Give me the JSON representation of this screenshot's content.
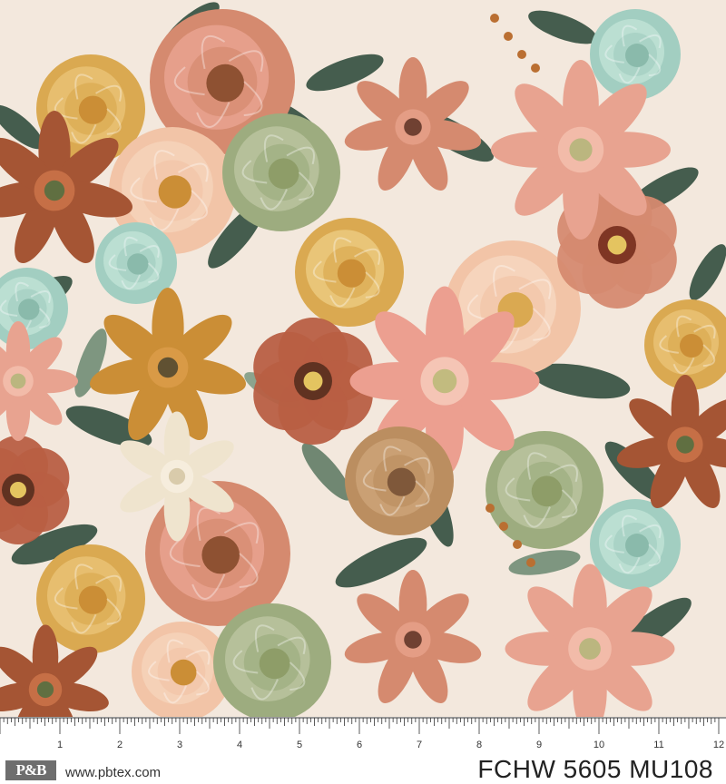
{
  "fabric": {
    "background_color": "#f3e8dc",
    "palette": {
      "rust": "#b6593c",
      "terracotta": "#d4866a",
      "salmon": "#e8a08c",
      "peach": "#f2c2a4",
      "mustard": "#d9a64a",
      "gold": "#c98a2e",
      "sage": "#9aa97a",
      "mint": "#9fcdbf",
      "forest": "#2f4a3a",
      "cream": "#f1e4d2",
      "brown": "#8a4a2a"
    }
  },
  "ruler": {
    "numbers": [
      "1",
      "2",
      "3",
      "4",
      "5",
      "6",
      "7",
      "8",
      "9",
      "10",
      "11",
      "12"
    ]
  },
  "footer": {
    "logo_text": "P&B",
    "website": "www.pbtex.com",
    "product_code": "FCHW 5605 MU108"
  }
}
